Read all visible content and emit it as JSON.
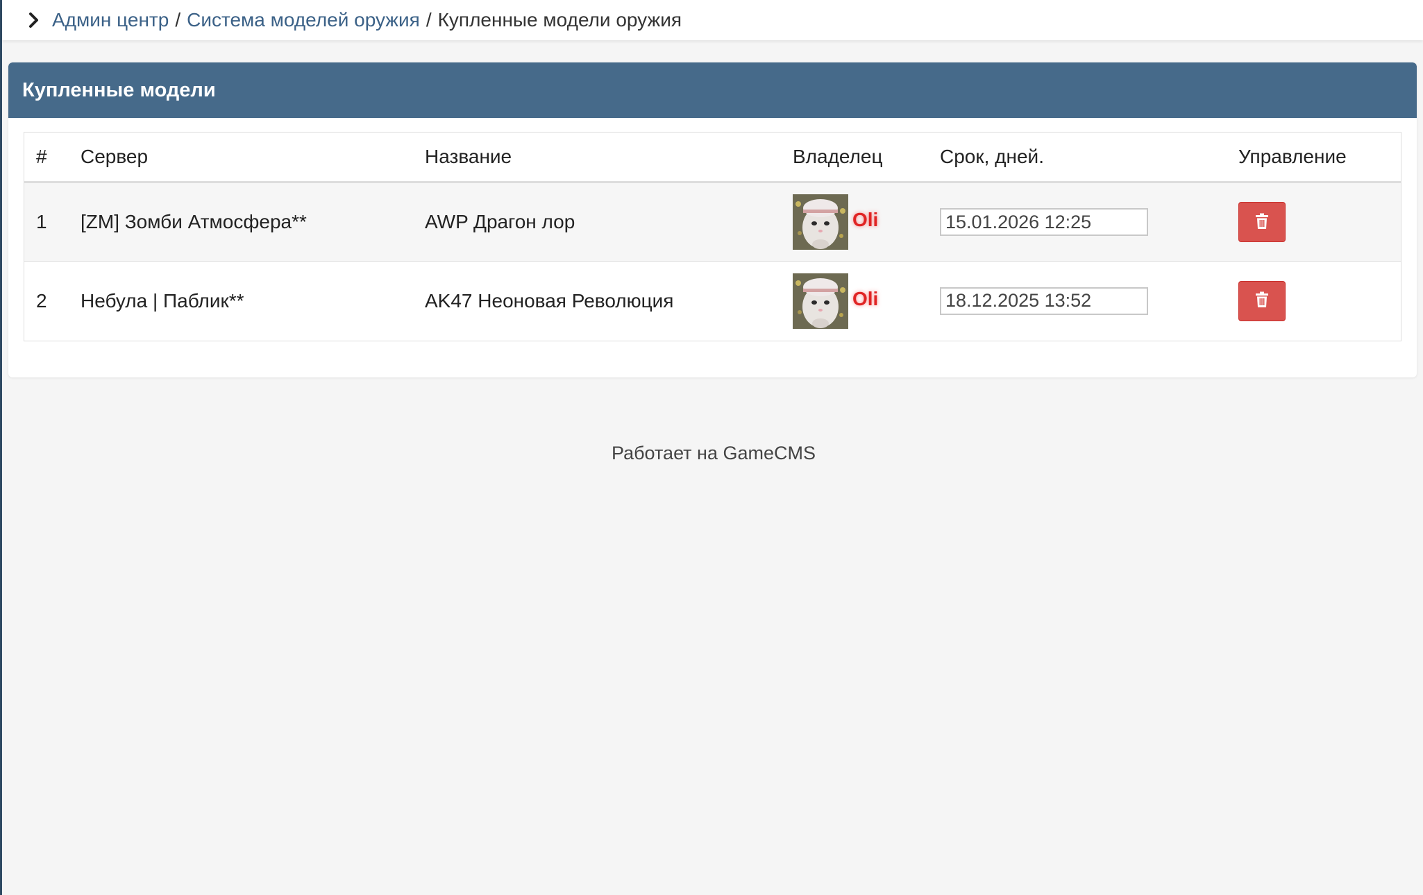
{
  "breadcrumb": {
    "items": [
      {
        "label": "Админ центр",
        "link": true
      },
      {
        "label": "Система моделей оружия",
        "link": true
      }
    ],
    "separator": "/",
    "current": "Купленные модели оружия"
  },
  "panel": {
    "title": "Купленные модели"
  },
  "table": {
    "columns": [
      "#",
      "Сервер",
      "Название",
      "Владелец",
      "Срок, дней.",
      "Управление"
    ],
    "rows": [
      {
        "num": "1",
        "server": "[ZM] Зомби Атмосфера**",
        "name": "AWP Драгон лор",
        "owner": "Oli",
        "term": "15.01.2026 12:25"
      },
      {
        "num": "2",
        "server": "Небула | Паблик**",
        "name": "AK47 Неоновая Революция",
        "owner": "Oli",
        "term": "18.12.2025 13:52"
      }
    ]
  },
  "footer": {
    "text": "Работает на GameCMS"
  },
  "colors": {
    "header_bg": "#466a8a",
    "link": "#3b6187",
    "owner_name": "#e02424",
    "delete_button": "#d9534f"
  },
  "icons": {
    "breadcrumb_toggle": "chevron-right-icon",
    "delete": "trash-icon"
  }
}
